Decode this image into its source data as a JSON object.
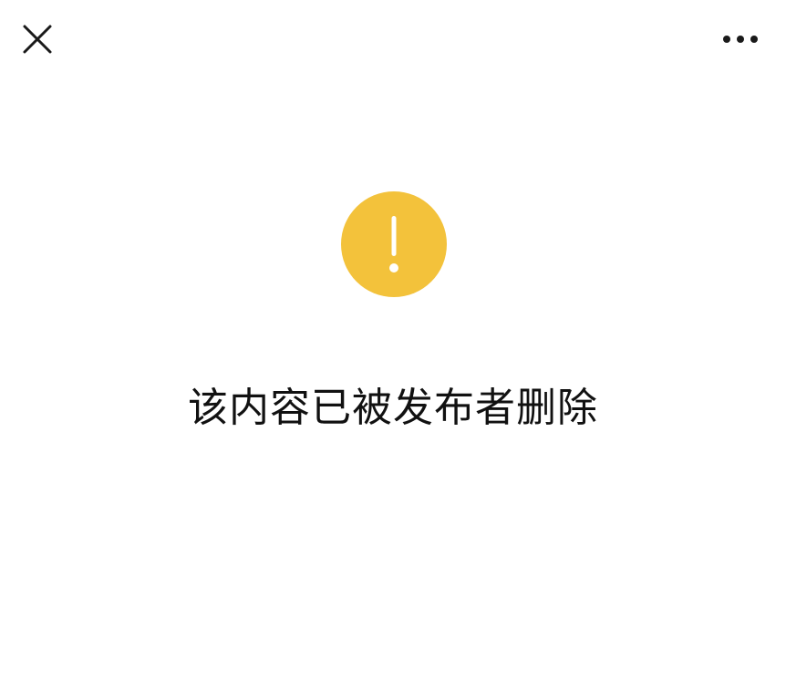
{
  "header": {
    "close_icon": "close-icon",
    "more_icon": "more-horizontal-icon"
  },
  "notice": {
    "icon": "exclamation-circle-icon",
    "icon_color": "#f3c23b",
    "message": "该内容已被发布者删除"
  }
}
